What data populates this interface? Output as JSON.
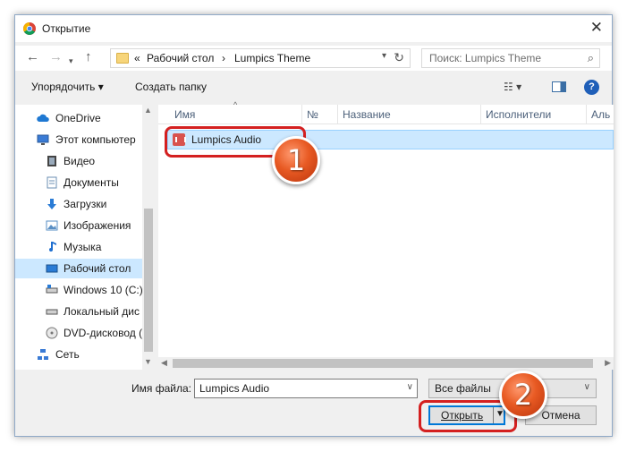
{
  "window": {
    "title": "Открытие",
    "close_label": "✕"
  },
  "nav": {
    "back": "←",
    "forward": "→",
    "recent": "▾",
    "up": "↑",
    "breadcrumb": {
      "overflow": "«",
      "parts": [
        "Рабочий стол",
        "Lumpics Theme"
      ],
      "separator": "›"
    },
    "refresh": "↻",
    "search_placeholder": "Поиск: Lumpics Theme"
  },
  "toolbar": {
    "organize_label": "Упорядочить ▾",
    "new_folder_label": "Создать папку",
    "view_label": "☷ ▾",
    "help_label": "?"
  },
  "sidebar": {
    "items": [
      {
        "label": "OneDrive",
        "icon": "cloud-icon",
        "color": "#1e78d2"
      },
      {
        "label": "Этот компьютер",
        "icon": "computer-icon",
        "color": "#3a7bd5"
      },
      {
        "label": "Видео",
        "icon": "video-icon",
        "color": "#444444"
      },
      {
        "label": "Документы",
        "icon": "document-icon",
        "color": "#6b8fb3"
      },
      {
        "label": "Загрузки",
        "icon": "download-icon",
        "color": "#2a7bd5"
      },
      {
        "label": "Изображения",
        "icon": "image-icon",
        "color": "#5a8fc4"
      },
      {
        "label": "Музыка",
        "icon": "music-icon",
        "color": "#1f6fd0"
      },
      {
        "label": "Рабочий стол",
        "icon": "desktop-icon",
        "color": "#2a7bd5"
      },
      {
        "label": "Windows 10 (C:)",
        "icon": "drive-icon",
        "color": "#555555"
      },
      {
        "label": "Локальный дис",
        "icon": "drive-icon",
        "color": "#555555"
      },
      {
        "label": "DVD-дисковод (",
        "icon": "dvd-icon",
        "color": "#777777"
      },
      {
        "label": "Сеть",
        "icon": "network-icon",
        "color": "#3a7bd5"
      }
    ],
    "selected_index": 7
  },
  "columns": [
    "Имя",
    "№",
    "Название",
    "Исполнители",
    "Аль"
  ],
  "files": [
    {
      "name": "Lumpics Audio",
      "icon": "audio-file-icon"
    }
  ],
  "bottom": {
    "filename_label": "Имя файла:",
    "filename_value": "Lumpics Audio",
    "filter_value": "Все файлы",
    "open_label": "Открыть",
    "cancel_label": "Отмена"
  },
  "callouts": {
    "one": "1",
    "two": "2"
  },
  "colors": {
    "accent": "#0078d7",
    "callout": "#e85a23",
    "highlight": "#d42020",
    "selection": "#cce8ff"
  }
}
